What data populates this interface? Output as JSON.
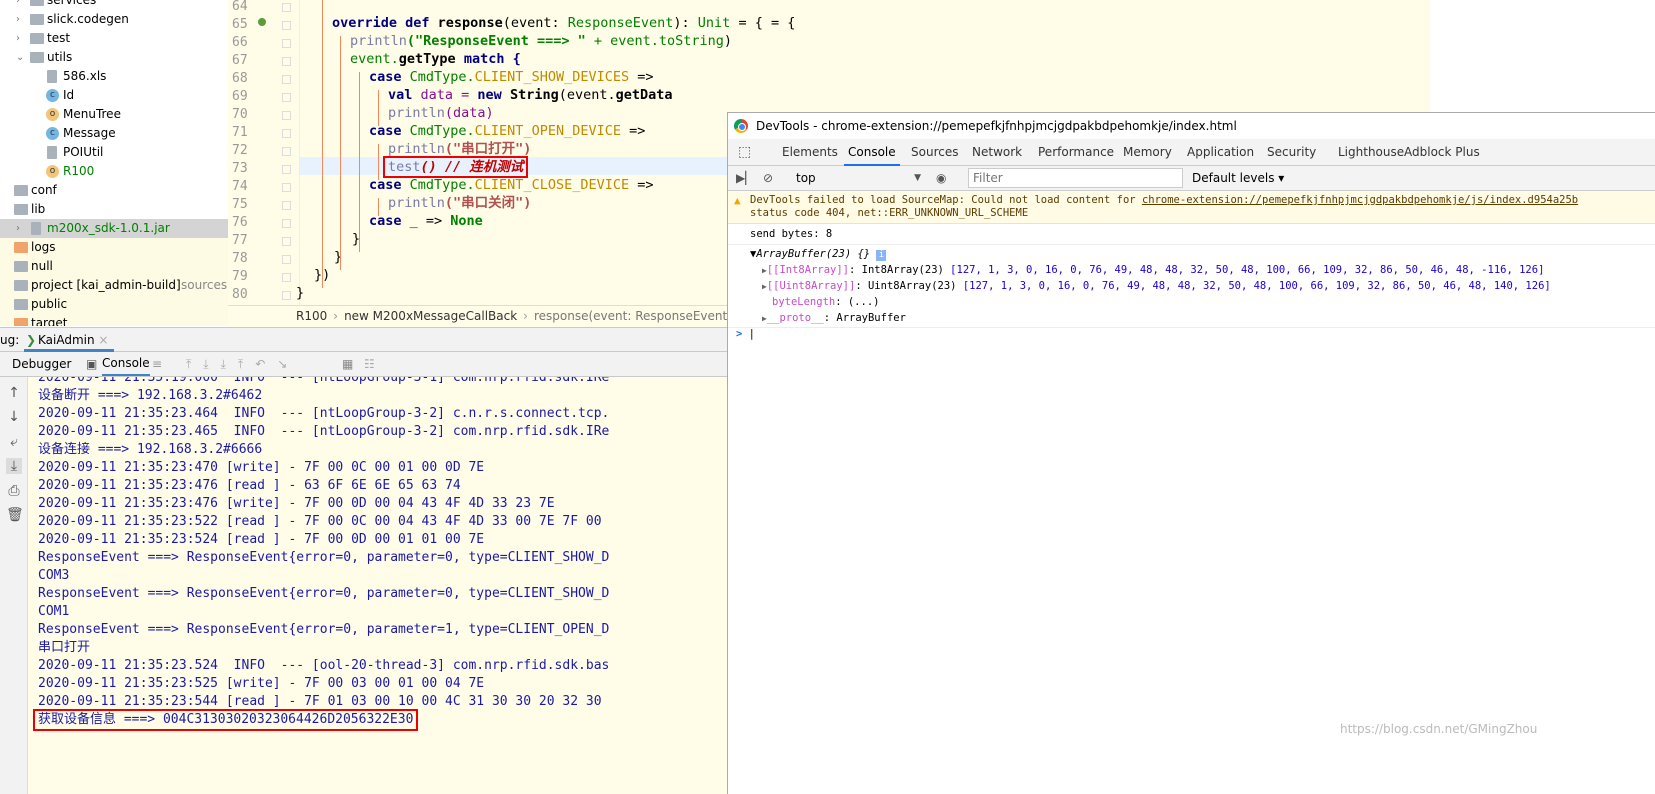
{
  "project_tree": {
    "items": [
      {
        "label": "services",
        "kind": "folder",
        "indent": 1,
        "chevron": "right"
      },
      {
        "label": "slick.codegen",
        "kind": "folder",
        "indent": 1,
        "chevron": "right"
      },
      {
        "label": "test",
        "kind": "folder",
        "indent": 1,
        "chevron": "right"
      },
      {
        "label": "utils",
        "kind": "folder",
        "indent": 1,
        "chevron": "down"
      },
      {
        "label": "586.xls",
        "kind": "file",
        "indent": 2
      },
      {
        "label": "Id",
        "kind": "class",
        "indent": 2
      },
      {
        "label": "MenuTree",
        "kind": "object",
        "indent": 2
      },
      {
        "label": "Message",
        "kind": "class",
        "indent": 2
      },
      {
        "label": "POIUtil",
        "kind": "file",
        "indent": 2
      },
      {
        "label": "R100",
        "kind": "object",
        "indent": 2,
        "color": "#008000"
      },
      {
        "label": "conf",
        "kind": "folder",
        "indent": 0
      },
      {
        "label": "lib",
        "kind": "folder",
        "indent": 0
      },
      {
        "label": "m200x_sdk-1.0.1.jar",
        "kind": "jar",
        "indent": 1,
        "chevron": "right",
        "selected": true,
        "color": "#008000"
      },
      {
        "label": "logs",
        "kind": "folder-orange",
        "indent": 0
      },
      {
        "label": "null",
        "kind": "folder",
        "indent": 0
      },
      {
        "label": "project [kai_admin-build]",
        "suffix": "sources",
        "kind": "folder",
        "indent": 0
      },
      {
        "label": "public",
        "kind": "folder",
        "indent": 0
      },
      {
        "label": "target",
        "kind": "folder-orange",
        "indent": 0
      }
    ]
  },
  "editor": {
    "line_numbers": [
      "64",
      "65",
      "66",
      "67",
      "68",
      "69",
      "70",
      "71",
      "72",
      "73",
      "74",
      "75",
      "76",
      "77",
      "78",
      "79",
      "80"
    ],
    "code": {
      "l65a": "override def ",
      "l65b": "response",
      "l65c": "(event: ",
      "l65d": "ResponseEvent",
      "l65e": "): ",
      "l65f": "Unit",
      " l65g": " = {",
      "l66a": "println",
      "l66b": "(\"ResponseEvent ===> \"",
      "l66c": " + event.",
      "l66d": "toString",
      "l66e": ")",
      "l67a": "event.",
      "l67b": "getType",
      "l67c": " match {",
      "l68a": "case ",
      "l68b": "CmdType.",
      "l68c": "CLIENT_SHOW_DEVICES",
      "l68d": " =>",
      "l69a": "val ",
      "l69b": "data = ",
      "l69c": "new ",
      "l69d": "String",
      "l69e": "(event.",
      "l69f": "getData",
      "l70a": "println",
      "l70b": "(data)",
      "l71a": "case ",
      "l71b": "CmdType.",
      "l71c": "CLIENT_OPEN_DEVICE",
      "l71d": " =>",
      "l72a": "println",
      "l72b": "(\"串口打开\")",
      "l73a": "test",
      "l73b": "() // 连机测试",
      "l74a": "case ",
      "l74b": "CmdType.",
      "l74c": "CLIENT_CLOSE_DEVICE",
      "l74d": " =>",
      "l75a": "println",
      "l75b": "(\"串口关闭\")",
      "l76a": "case ",
      "l76b": "_ => ",
      "l76c": "None",
      "l77": "}",
      "l78": "}",
      "l79": "})",
      "l80": "}"
    }
  },
  "breadcrumb": [
    "R100",
    "new M200xMessageCallBack",
    "response(event: ResponseEvent)"
  ],
  "debug": {
    "label": "ug:",
    "run_tab": "KaiAdmin",
    "tabs": [
      "Debugger",
      "Console"
    ]
  },
  "console_lines": [
    "2020-09-11 21:35:19.000  INFO  --- [ntLoopGroup-3-1] com.nrp.rfid.sdk.IRe",
    "设备断开 ===> 192.168.3.2#6462",
    "2020-09-11 21:35:23.464  INFO  --- [ntLoopGroup-3-2] c.n.r.s.connect.tcp.",
    "2020-09-11 21:35:23.465  INFO  --- [ntLoopGroup-3-2] com.nrp.rfid.sdk.IRe",
    "设备连接 ===> 192.168.3.2#6666",
    "2020-09-11 21:35:23:470 [write] - 7F 00 0C 00 01 00 0D 7E",
    "2020-09-11 21:35:23:476 [read ] - 63 6F 6E 6E 65 63 74",
    "2020-09-11 21:35:23:476 [write] - 7F 00 0D 00 04 43 4F 4D 33 23 7E",
    "2020-09-11 21:35:23:522 [read ] - 7F 00 0C 00 04 43 4F 4D 33 00 7E 7F 00",
    "2020-09-11 21:35:23:524 [read ] - 7F 00 0D 00 01 01 00 7E",
    "ResponseEvent ===> ResponseEvent{error=0, parameter=0, type=CLIENT_SHOW_D",
    "COM3",
    "ResponseEvent ===> ResponseEvent{error=0, parameter=0, type=CLIENT_SHOW_D",
    "COM1",
    "ResponseEvent ===> ResponseEvent{error=0, parameter=1, type=CLIENT_OPEN_D",
    "串口打开",
    "2020-09-11 21:35:23.524  INFO  --- [ool-20-thread-3] com.nrp.rfid.sdk.bas",
    "2020-09-11 21:35:23:525 [write] - 7F 00 03 00 01 00 04 7E",
    "2020-09-11 21:35:23:544 [read ] - 7F 01 03 00 10 00 4C 31 30 30 20 32 30",
    "获取设备信息 ===> 004C31303020323064426D2056322E30"
  ],
  "devtools": {
    "title": "DevTools - chrome-extension://pemepefkjfnhpjmcjgdpakbdpehomkje/index.html",
    "tabs": [
      "Elements",
      "Console",
      "Sources",
      "Network",
      "Performance",
      "Memory",
      "Application",
      "Security",
      "Lighthouse",
      "Adblock Plus"
    ],
    "active_tab": "Console",
    "context": "top",
    "filter_placeholder": "Filter",
    "levels": "Default levels ▾",
    "warning_line1": "DevTools failed to load SourceMap: Could not load content for ",
    "warning_link": "chrome-extension://pemepefkjfnhpjmcjgdpakbdpehomkje/js/index.d954a25b",
    "warning_line2": "status code 404, net::ERR_UNKNOWN_URL_SCHEME",
    "send_bytes": "send bytes: 8",
    "arraybuffer": "▼ArrayBuffer(23) {}",
    "int8_key": "[[Int8Array]]",
    "int8_type": ": Int8Array(23) ",
    "int8_vals": "[127, 1, 3, 0, 16, 0, 76, 49, 48, 48, 32, 50, 48, 100, 66, 109, 32, 86, 50, 46, 48, -116, 126]",
    "uint8_key": "[[Uint8Array]]",
    "uint8_type": ": Uint8Array(23) ",
    "uint8_vals": "[127, 1, 3, 0, 16, 0, 76, 49, 48, 48, 32, 50, 48, 100, 66, 109, 32, 86, 50, 46, 48, 140, 126]",
    "bytelength_key": "byteLength",
    "bytelength_val": ": (...)",
    "proto_key": "__proto__",
    "proto_val": ": ArrayBuffer",
    "prompt": ">"
  },
  "watermark": "https://blog.csdn.net/GMingZhou",
  "colors": {
    "highlight_box": "#e00000",
    "editor_bg": "#fffde8",
    "console_text": "#1a1aa6",
    "devtools_accent": "#1a73e8"
  }
}
